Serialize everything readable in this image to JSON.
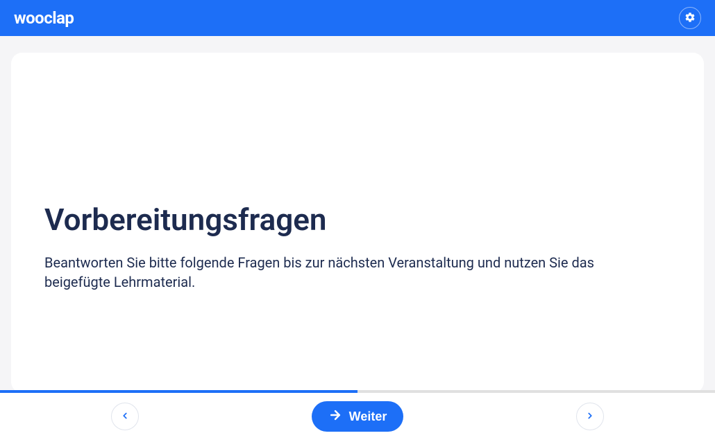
{
  "header": {
    "logo": "wooclap"
  },
  "content": {
    "title": "Vorbereitungsfragen",
    "description": "Beantworten Sie bitte folgende Fragen bis zur nächsten Veranstaltung und nutzen Sie das beigefügte Lehrmaterial."
  },
  "footer": {
    "continue_label": "Weiter"
  },
  "progress": {
    "percent": 50
  }
}
